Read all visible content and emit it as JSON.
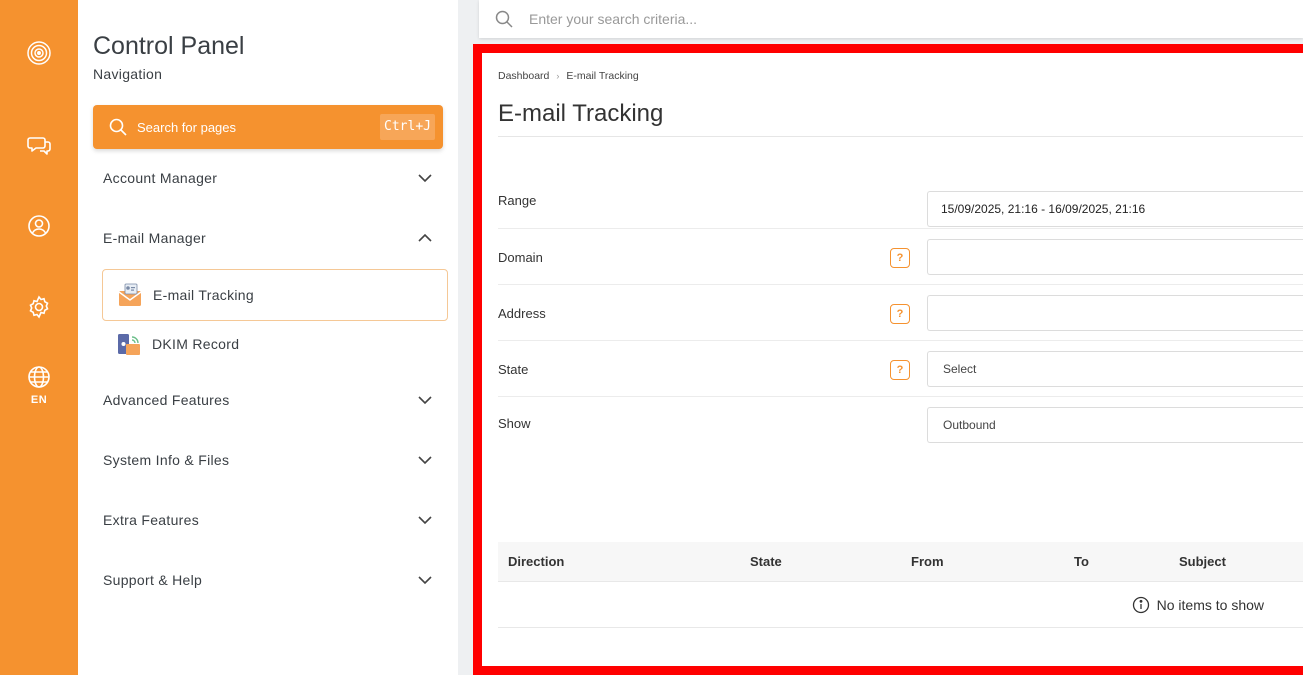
{
  "rail": {
    "lang": "EN"
  },
  "sidebar": {
    "title": "Control Panel",
    "subtitle": "Navigation",
    "search_label": "Search for pages",
    "search_shortcut": "Ctrl+J",
    "items": [
      {
        "label": "Account Manager"
      },
      {
        "label": "E-mail Manager"
      },
      {
        "label": "Advanced Features"
      },
      {
        "label": "System Info & Files"
      },
      {
        "label": "Extra Features"
      },
      {
        "label": "Support & Help"
      }
    ],
    "subitems": [
      {
        "label": "E-mail Tracking"
      },
      {
        "label": "DKIM Record"
      }
    ]
  },
  "topbar": {
    "placeholder": "Enter your search criteria..."
  },
  "breadcrumb": {
    "root": "Dashboard",
    "current": "E-mail Tracking"
  },
  "page": {
    "title": "E-mail Tracking"
  },
  "form": {
    "range_label": "Range",
    "range_value": "15/09/2025, 21:16 - 16/09/2025, 21:16",
    "domain_label": "Domain",
    "address_label": "Address",
    "state_label": "State",
    "state_value": "Select",
    "show_label": "Show",
    "show_value": "Outbound",
    "help_glyph": "?"
  },
  "table": {
    "columns": [
      "Direction",
      "State",
      "From",
      "To",
      "Subject"
    ],
    "empty_message": "No items to show"
  },
  "colors": {
    "accent": "#f5922f",
    "highlight_border": "#ff0000"
  }
}
